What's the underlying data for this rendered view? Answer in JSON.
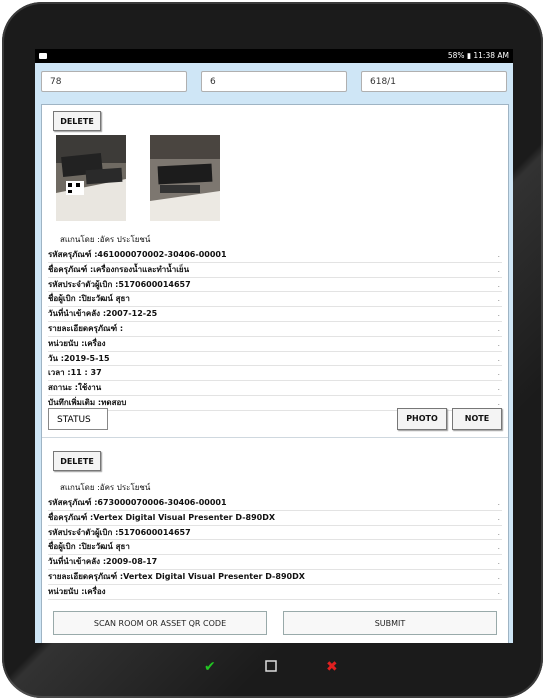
{
  "statusbar": {
    "right_text": "58% ▮ 11:38 AM"
  },
  "inputs": {
    "field1": "78",
    "field2": "6",
    "field3": "618/1"
  },
  "record1": {
    "delete_label": "DELETE",
    "scanned_by": "สแกนโดย :อัคร ประโยชน์",
    "rows": [
      "รหัสครุภัณฑ์ :461000070002-30406-00001",
      "ชื่อครุภัณฑ์ :เครื่องกรองน้ำและทำน้ำเย็น",
      "รหัสประจำตัวผู้เบิก :5170600014657",
      "ชื่อผู้เบิก :ปิยะวัฒน์ สุธา",
      "วันที่นำเข้าคลัง :2007-12-25",
      "รายละเอียดครุภัณฑ์ :",
      "หน่วยนับ :เครื่อง",
      "วัน :2019-5-15",
      "เวลา :11 : 37",
      "สถานะ :ใช้งาน",
      "บันทึกเพิ่มเติม :ทดสอบ"
    ],
    "status_label": "STATUS",
    "photo_label": "PHOTO",
    "note_label": "NOTE"
  },
  "record2": {
    "delete_label": "DELETE",
    "scanned_by": "สแกนโดย :อัคร ประโยชน์",
    "rows": [
      "รหัสครุภัณฑ์ :673000070006-30406-00001",
      "ชื่อครุภัณฑ์ :Vertex Digital Visual Presenter D-890DX",
      "รหัสประจำตัวผู้เบิก :5170600014657",
      "ชื่อผู้เบิก :ปิยะวัฒน์ สุธา",
      "วันที่นำเข้าคลัง :2009-08-17",
      "รายละเอียดครุภัณฑ์ :Vertex Digital Visual Presenter D-890DX",
      "หน่วยนับ :เครื่อง"
    ]
  },
  "actions": {
    "scan_label": "SCAN ROOM OR ASSET QR CODE",
    "submit_label": "SUBMIT"
  },
  "colors": {
    "screen_bg": "#cfe6f6",
    "nav_check": "#22c522",
    "nav_cross": "#e02020"
  }
}
